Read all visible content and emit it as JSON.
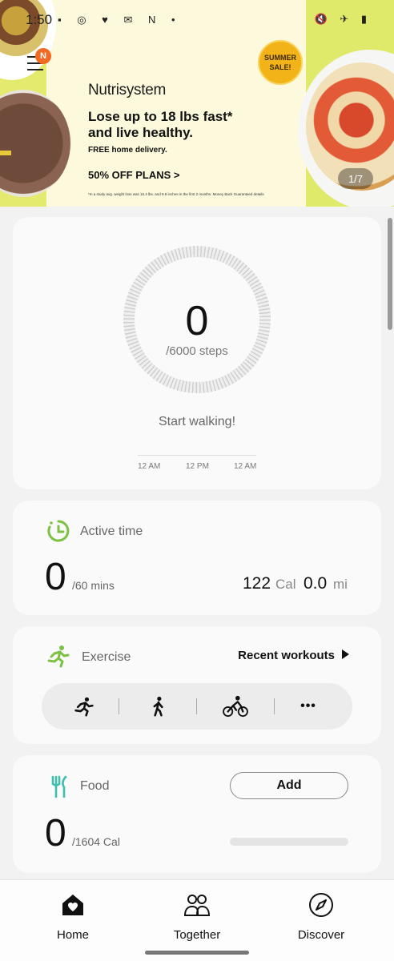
{
  "status_bar": {
    "time": "1:50",
    "left_icons": "▪ ◎ ♥ ✉ N •",
    "right_icons": "🔇 ✈ ▮"
  },
  "menu": {
    "notification_badge": "N"
  },
  "ad": {
    "badge_line1": "SUMMER",
    "badge_line2": "SALE!",
    "brand": "Nutrisystem",
    "headline": "Lose up to 18 lbs fast* and live healthy.",
    "subline": "FREE home delivery.",
    "cta": "50% OFF PLANS >",
    "fine_print": "*In a study avg. weight loss was 15.4 lbs. and 9.8 inches in the first 2 months. Money Back Guaranteed details",
    "pager": "1/7"
  },
  "steps": {
    "count": "0",
    "goal": "/6000 steps",
    "message": "Start walking!",
    "timeline": [
      "12 AM",
      "12 PM",
      "12 AM"
    ]
  },
  "active_time": {
    "label": "Active time",
    "value": "0",
    "unit": "/60 mins",
    "calories_value": "122",
    "calories_unit": "Cal",
    "distance_value": "0.0",
    "distance_unit": "mi"
  },
  "exercise": {
    "label": "Exercise",
    "recent_workouts": "Recent workouts",
    "buttons": [
      "running-icon",
      "walking-icon",
      "cycling-icon",
      "more-icon"
    ],
    "more_label": "•••"
  },
  "food": {
    "label": "Food",
    "add_label": "Add",
    "value": "0",
    "unit": "/1604 Cal"
  },
  "bottom_nav": {
    "items": [
      {
        "label": "Home",
        "icon": "home-icon"
      },
      {
        "label": "Together",
        "icon": "together-icon"
      },
      {
        "label": "Discover",
        "icon": "compass-icon"
      }
    ]
  },
  "colors": {
    "accent_green": "#7bc142",
    "badge_orange": "#f26a21",
    "sale_yellow": "#f2b318"
  }
}
